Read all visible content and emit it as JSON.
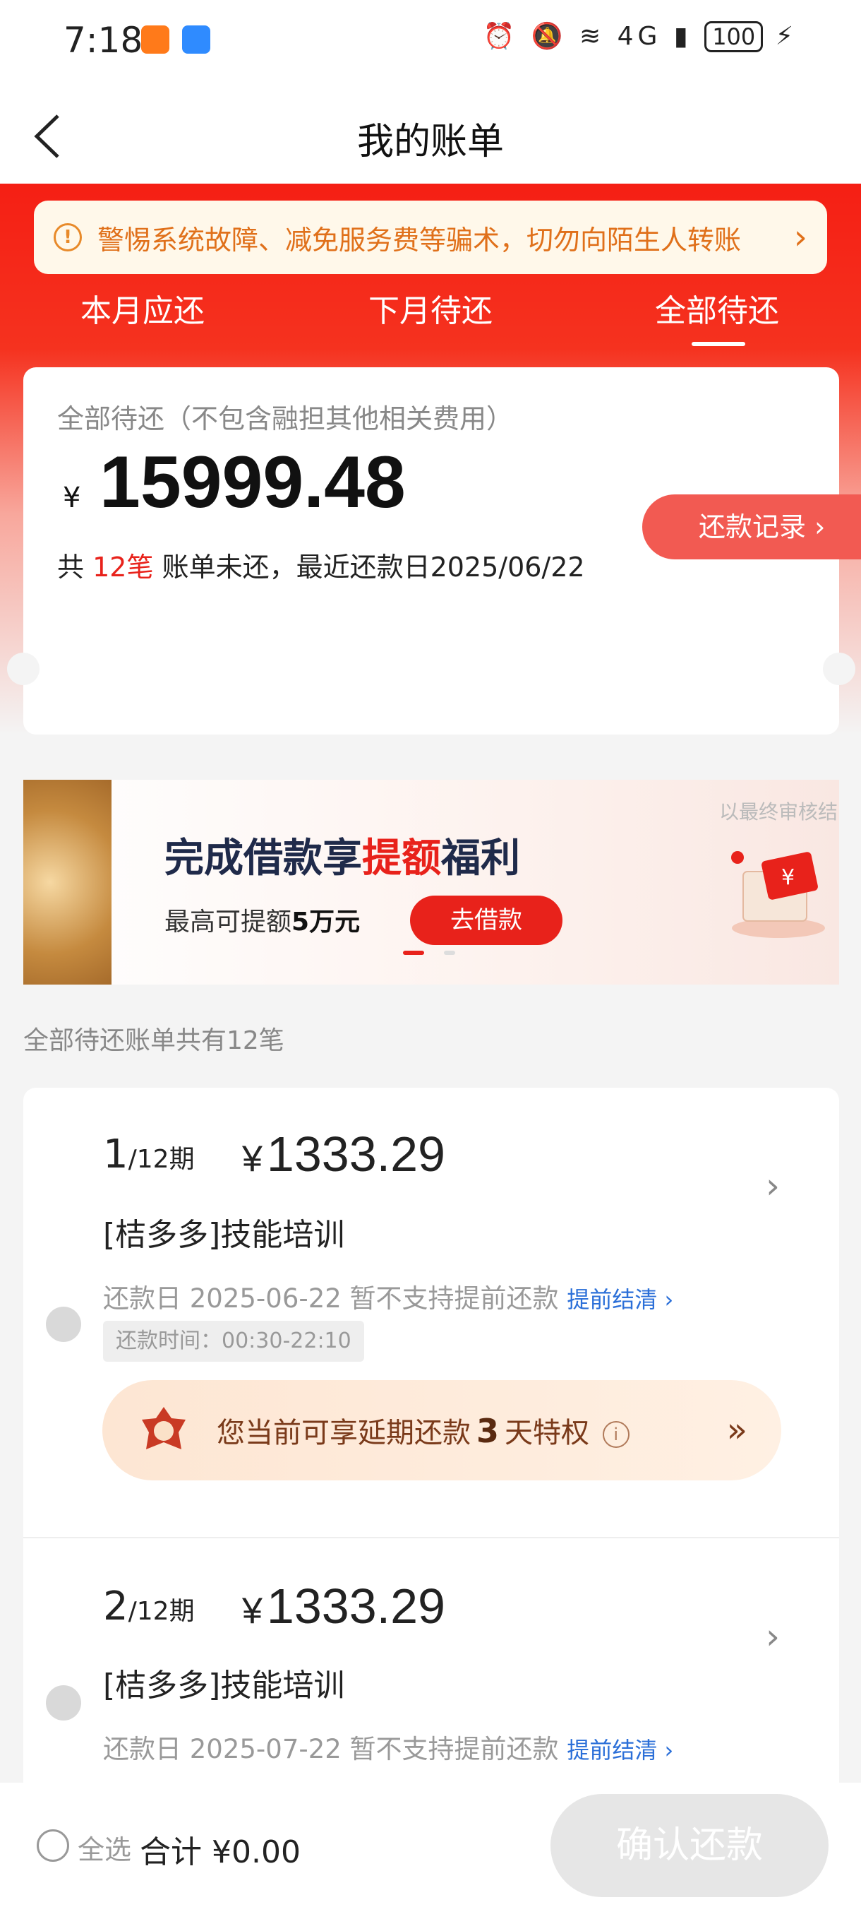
{
  "status_bar": {
    "time": "7:18",
    "signal_text": "4G",
    "battery": "100"
  },
  "nav": {
    "title": "我的账单",
    "back_icon": "chevron-left-icon"
  },
  "notice": {
    "text": "警惕系统故障、减免服务费等骗术，切勿向陌生人转账",
    "icon": "warning-icon"
  },
  "tabs": [
    {
      "label": "本月应还"
    },
    {
      "label": "下月待还"
    },
    {
      "label": "全部待还",
      "active": true
    }
  ],
  "summary": {
    "label": "全部待还（不包含融担其他相关费用）",
    "currency": "¥",
    "amount": "15999.48",
    "info_prefix": "共",
    "count": "12笔",
    "info_suffix": "账单未还，最近还款日2025/06/22"
  },
  "record_button": "还款记录 ›",
  "banner": {
    "note": "以最终审核结",
    "title_pre": "完成借款享",
    "title_hl": "提额",
    "title_post": "福利",
    "sub_pre": "最高可提额",
    "sub_bold": "5万元",
    "button": "去借款"
  },
  "list_count": "全部待还账单共有12笔",
  "bills": [
    {
      "period": "1",
      "total": "/12期",
      "currency": "¥",
      "amount": "1333.29",
      "name": "[桔多多]技能培训",
      "date_text": "还款日 2025-06-22 暂不支持提前还款",
      "link": "提前结清 ›",
      "time_text": "还款时间：00:30-22:10",
      "privilege_pre": "您当前可享延期还款",
      "privilege_days": "3",
      "privilege_post": "天特权"
    },
    {
      "period": "2",
      "total": "/12期",
      "currency": "¥",
      "amount": "1333.29",
      "name": "[桔多多]技能培训",
      "date_text": "还款日 2025-07-22 暂不支持提前还款",
      "link": "提前结清 ›"
    }
  ],
  "bottom": {
    "select_all": "全选",
    "total_label": "合计 ¥0.00",
    "confirm": "确认还款"
  },
  "colors": {
    "brand_red": "#e8221b",
    "notice_orange": "#e0701a",
    "link_blue": "#2b6fd8"
  }
}
